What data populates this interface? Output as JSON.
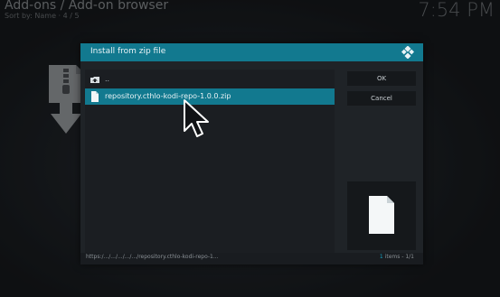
{
  "background": {
    "title": "Add-ons / Add-on browser",
    "subtitle": "Sort by: Name",
    "position": "4 / 5",
    "clock": "7:54 PM",
    "icon": "zip-download-icon"
  },
  "dialog": {
    "title": "Install from zip file",
    "logo_icon": "kodi-logo-icon",
    "accent_color": "#12798f",
    "items": [
      {
        "label": "..",
        "icon": "parent-folder-icon"
      },
      {
        "label": "repository.cthlo-kodi-repo-1.0.0.zip",
        "icon": "file-icon",
        "selected": true
      }
    ],
    "buttons": {
      "ok": "OK",
      "cancel": "Cancel"
    },
    "preview_icon": "file-icon",
    "footer": {
      "path": "https:/.../.../.../.../.../repository.cthlo-kodi-repo-1...",
      "count_number": "1",
      "count_rest": "items - 1/1"
    }
  }
}
